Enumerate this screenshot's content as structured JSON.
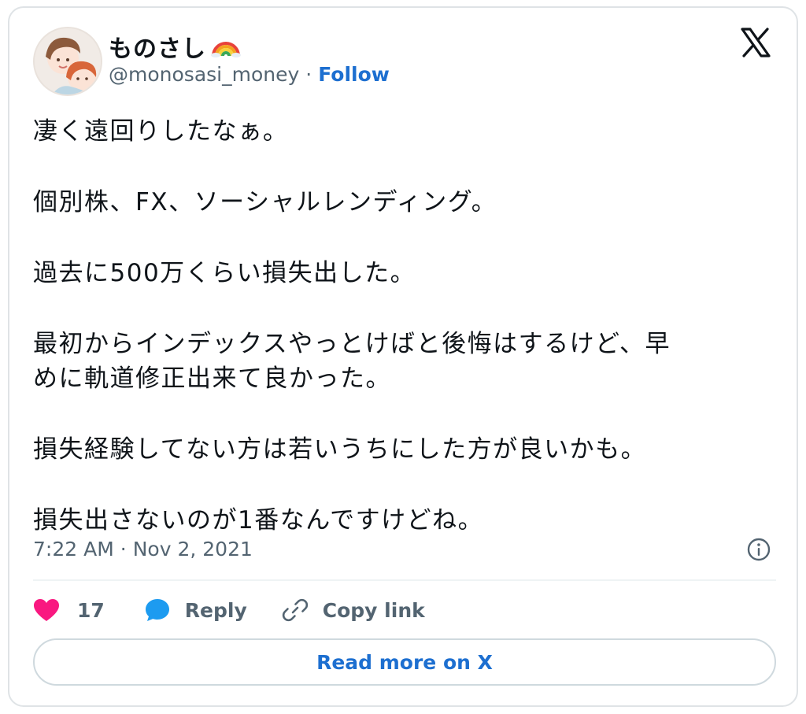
{
  "author": {
    "display_name": "ものさし",
    "name_emoji_icon": "rainbow-icon",
    "handle": "@monosasi_money",
    "separator": "·",
    "follow_label": "Follow"
  },
  "brand_icon": "x-logo-icon",
  "tweet": {
    "lines": [
      "凄く遠回りしたなぁ。",
      "個別株、FX、ソーシャルレンディング。",
      "過去に500万くらい損失出した。",
      "最初からインデックスやっとけばと後悔はするけど、早",
      "めに軌道修正出来て良かった。",
      "損失経験してない方は若いうちにした方が良いかも。",
      "損失出さないのが1番なんですけどね。"
    ]
  },
  "meta": {
    "time": "7:22 AM",
    "separator": "·",
    "date": "Nov 2, 2021",
    "info_icon": "info-icon"
  },
  "actions": {
    "like_icon": "heart-icon",
    "like_count": "17",
    "reply_icon": "speech-bubble-icon",
    "reply_label": "Reply",
    "copy_icon": "link-icon",
    "copy_label": "Copy link"
  },
  "read_more_label": "Read more on X",
  "colors": {
    "like": "#f91880",
    "reply": "#1d9bf0",
    "link": "#1d6fd0",
    "text": "#0f1419",
    "muted": "#536471",
    "border": "#dfe3e6"
  }
}
